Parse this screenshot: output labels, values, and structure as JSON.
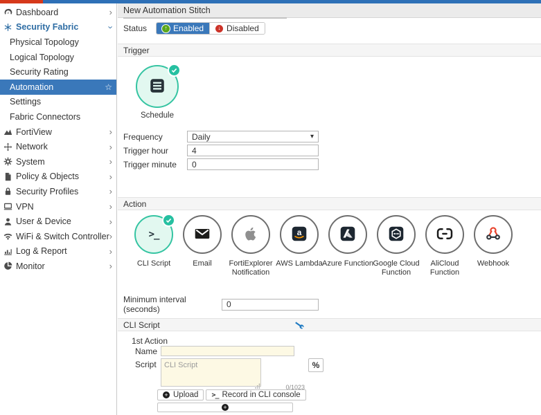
{
  "colors": {
    "topbar_red": "#d6391b",
    "topbar_blue": "#2e70b7",
    "accent_blue": "#3a78ba",
    "selected_teal": "#35c4a2",
    "selected_fill": "#e2f8f0",
    "enabled_green": "#5ba71b",
    "disabled_red": "#cc3329",
    "input_yellow": "#fdf9e4"
  },
  "sidebar": {
    "items": [
      {
        "label": "Dashboard",
        "icon": "dashboard-icon",
        "type": "top",
        "chevron": "right"
      },
      {
        "label": "Security Fabric",
        "icon": "security-fabric-icon",
        "type": "top",
        "chevron": "down",
        "expanded": true
      },
      {
        "label": "Physical Topology",
        "type": "sub"
      },
      {
        "label": "Logical Topology",
        "type": "sub"
      },
      {
        "label": "Security Rating",
        "type": "sub"
      },
      {
        "label": "Automation",
        "type": "sub",
        "selected": true,
        "star": "☆"
      },
      {
        "label": "Settings",
        "type": "sub"
      },
      {
        "label": "Fabric Connectors",
        "type": "sub"
      },
      {
        "label": "FortiView",
        "icon": "fortiview-icon",
        "type": "top",
        "chevron": "right"
      },
      {
        "label": "Network",
        "icon": "network-icon",
        "type": "top",
        "chevron": "right"
      },
      {
        "label": "System",
        "icon": "gear-icon",
        "type": "top",
        "chevron": "right"
      },
      {
        "label": "Policy & Objects",
        "icon": "policy-icon",
        "type": "top",
        "chevron": "right"
      },
      {
        "label": "Security Profiles",
        "icon": "lock-icon",
        "type": "top",
        "chevron": "right"
      },
      {
        "label": "VPN",
        "icon": "vpn-icon",
        "type": "top",
        "chevron": "right"
      },
      {
        "label": "User & Device",
        "icon": "user-icon",
        "type": "top",
        "chevron": "right"
      },
      {
        "label": "WiFi & Switch Controller",
        "icon": "wifi-icon",
        "type": "top",
        "chevron": "right"
      },
      {
        "label": "Log & Report",
        "icon": "log-icon",
        "type": "top",
        "chevron": "right"
      },
      {
        "label": "Monitor",
        "icon": "monitor-icon",
        "type": "top",
        "chevron": "right"
      }
    ]
  },
  "header": {
    "title": "New Automation Stitch"
  },
  "status": {
    "label": "Status",
    "enabled_label": "Enabled",
    "disabled_label": "Disabled",
    "selected": "Enabled"
  },
  "trigger": {
    "section_label": "Trigger",
    "selected_option": {
      "label": "Schedule",
      "icon": "schedule-icon",
      "selected": true
    },
    "fields": [
      {
        "label": "Frequency",
        "value": "Daily",
        "type": "select"
      },
      {
        "label": "Trigger hour",
        "value": "4",
        "type": "input"
      },
      {
        "label": "Trigger minute",
        "value": "0",
        "type": "input"
      }
    ]
  },
  "action": {
    "section_label": "Action",
    "options": [
      {
        "label": "CLI Script",
        "icon": "cli-terminal-icon",
        "selected": true
      },
      {
        "label": "Email",
        "icon": "email-envelope-icon"
      },
      {
        "label": "FortiExplorer Notification",
        "icon": "apple-icon"
      },
      {
        "label": "AWS Lambda",
        "icon": "aws-lambda-icon"
      },
      {
        "label": "Azure Function",
        "icon": "azure-icon"
      },
      {
        "label": "Google Cloud Function",
        "icon": "google-cloud-icon"
      },
      {
        "label": "AliCloud Function",
        "icon": "alicloud-icon"
      },
      {
        "label": "Webhook",
        "icon": "webhook-icon"
      }
    ],
    "min_interval_label": "Minimum interval (seconds)",
    "min_interval_value": "0"
  },
  "cli": {
    "section_label": "CLI Script",
    "first_action_label": "1st Action",
    "name_label": "Name",
    "name_value": "",
    "script_label": "Script",
    "script_placeholder": "CLI Script",
    "script_value": "",
    "char_counter": "0/1023",
    "percent_button": "%",
    "upload_label": "Upload",
    "record_label": "Record in CLI console"
  }
}
